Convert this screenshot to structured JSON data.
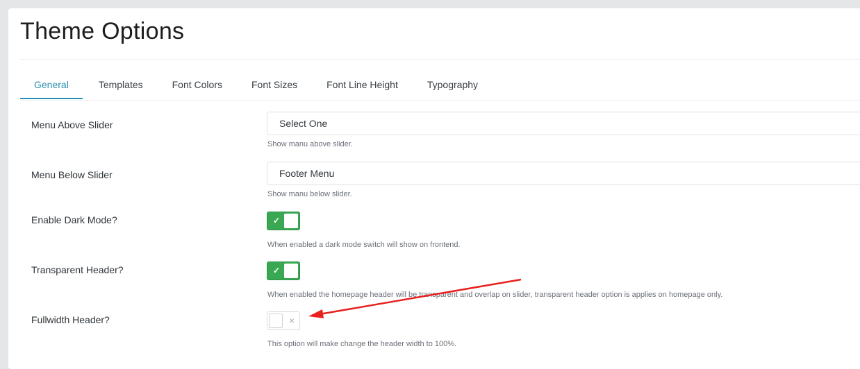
{
  "page": {
    "title": "Theme Options"
  },
  "tabs": [
    {
      "label": "General",
      "active": true
    },
    {
      "label": "Templates"
    },
    {
      "label": "Font Colors"
    },
    {
      "label": "Font Sizes"
    },
    {
      "label": "Font Line Height"
    },
    {
      "label": "Typography"
    }
  ],
  "settings": {
    "menu_above_slider": {
      "label": "Menu Above Slider",
      "value": "Select One",
      "help": "Show manu above slider."
    },
    "menu_below_slider": {
      "label": "Menu Below Slider",
      "value": "Footer Menu",
      "help": "Show manu below slider."
    },
    "dark_mode": {
      "label": "Enable Dark Mode?",
      "enabled": true,
      "icon": "check-icon",
      "help": "When enabled a dark mode switch will show on frontend."
    },
    "transparent_header": {
      "label": "Transparent Header?",
      "enabled": true,
      "icon": "check-icon",
      "help": "When enabled the homepage header will be transparent and overlap on slider, transparent header option is applies on homepage only."
    },
    "fullwidth_header": {
      "label": "Fullwidth Header?",
      "enabled": false,
      "icon": "x-icon",
      "help": "This option will make change the header width to 100%."
    }
  },
  "annotation": {
    "arrow_color": "#e8211e"
  },
  "colors": {
    "accent": "#2b8fb3",
    "toggle_on": "#3aa853"
  }
}
